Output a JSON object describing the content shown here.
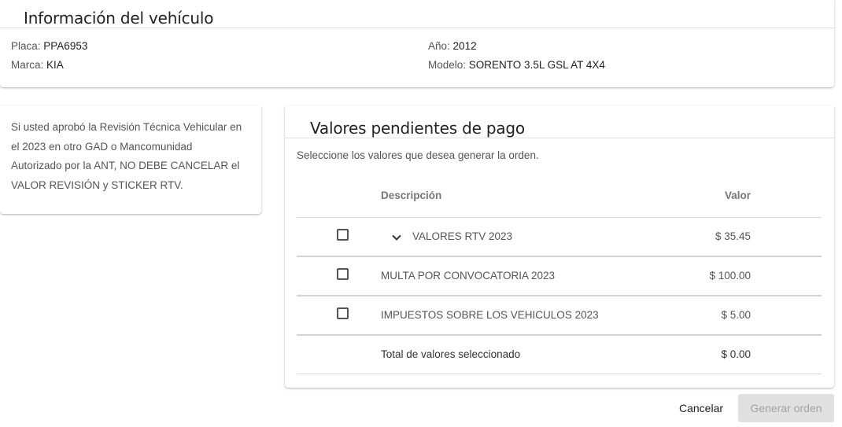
{
  "vehicle": {
    "title": "Información del vehículo",
    "plate_label": "Placa:",
    "plate_value": "PPA6953",
    "brand_label": "Marca:",
    "brand_value": "KIA",
    "year_label": "Año:",
    "year_value": "2012",
    "model_label": "Modelo:",
    "model_value": "SORENTO 3.5L GSL AT 4X4"
  },
  "notice": {
    "lines": [
      "Si usted aprobó la Revisión Técnica Vehicular en",
      "el 2023 en otro GAD o Mancomunidad",
      "Autorizado por la ANT, NO DEBE CANCELAR el",
      "VALOR REVISIÓN y STICKER RTV."
    ]
  },
  "pending": {
    "title": "Valores pendientes de pago",
    "subtitle": "Seleccione los valores que desea generar la orden.",
    "columns": {
      "description": "Descripción",
      "value": "Valor"
    },
    "rows": [
      {
        "description": "VALORES RTV 2023",
        "value": "$ 35.45",
        "checked": false,
        "expandable": true
      },
      {
        "description": "MULTA POR CONVOCATORIA 2023",
        "value": "$ 100.00",
        "checked": false,
        "expandable": false
      },
      {
        "description": "IMPUESTOS SOBRE LOS VEHICULOS 2023",
        "value": "$ 5.00",
        "checked": false,
        "expandable": false
      }
    ],
    "total": {
      "label": "Total de valores seleccionado",
      "value": "$ 0.00"
    }
  },
  "footer": {
    "cancel_label": "Cancelar",
    "generate_label": "Generar orden",
    "generate_disabled": true
  },
  "icons": {
    "expand": "chevron-down-icon",
    "checkbox": "checkbox-unchecked-icon"
  }
}
